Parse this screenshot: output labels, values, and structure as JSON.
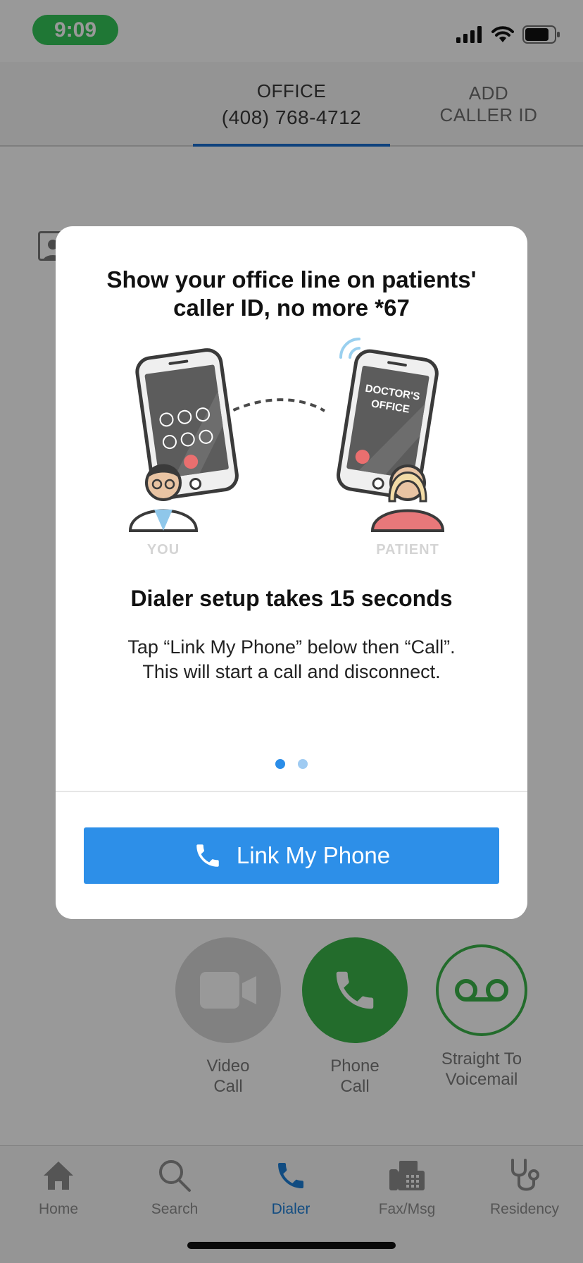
{
  "status_bar": {
    "time": "9:09"
  },
  "caller_tabs": {
    "office_label": "OFFICE",
    "office_number": "(408) 768-4712",
    "add_line1": "ADD",
    "add_line2": "CALLER ID"
  },
  "actions": {
    "video_line1": "Video",
    "video_line2": "Call",
    "phone_line1": "Phone",
    "phone_line2": "Call",
    "voicemail_line1": "Straight To",
    "voicemail_line2": "Voicemail"
  },
  "tab_bar": {
    "home": "Home",
    "search": "Search",
    "dialer": "Dialer",
    "fax": "Fax/Msg",
    "residency": "Residency"
  },
  "modal": {
    "title_line1": "Show your office line on patients'",
    "title_line2": "caller ID, no more *67",
    "illustration": {
      "phone_screen_line1": "DOCTOR'S",
      "phone_screen_line2": "OFFICE",
      "you_label": "YOU",
      "patient_label": "PATIENT"
    },
    "setup_title": "Dialer setup takes 15 seconds",
    "setup_line1": "Tap “Link My Phone” below then “Call”.",
    "setup_line2": "This will start a call and disconnect.",
    "page_count": 2,
    "active_page": 1,
    "button_label": "Link My Phone"
  },
  "colors": {
    "accent_blue": "#2d8fe8",
    "tab_underline": "#1a6fd0",
    "call_green": "#3bb54a",
    "time_pill": "#34c759",
    "dot_inactive": "#9fcbf2"
  }
}
